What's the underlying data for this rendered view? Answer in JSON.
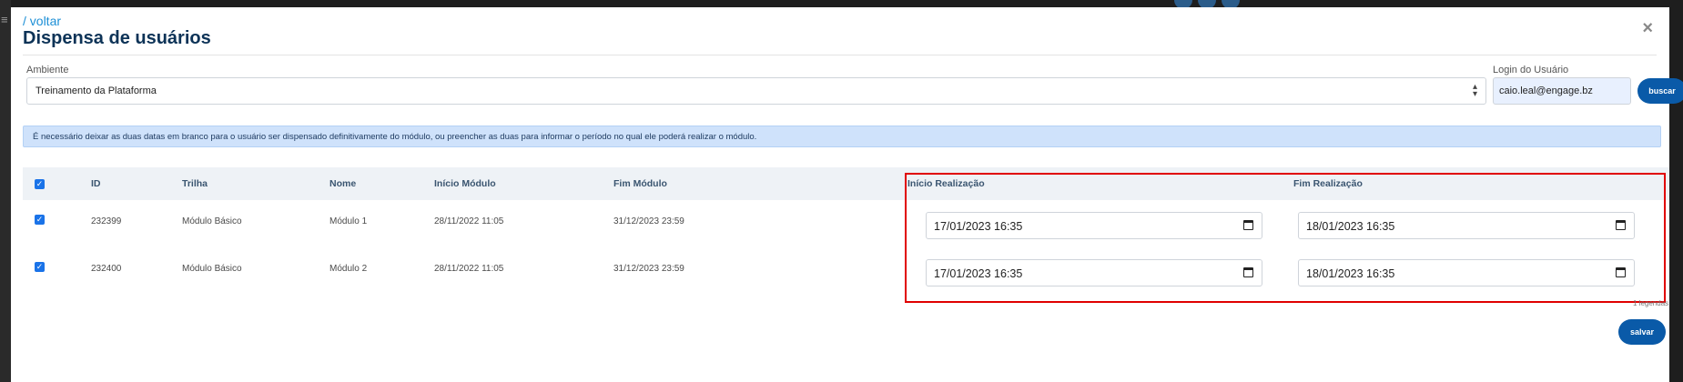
{
  "header": {
    "back_label": "/ voltar",
    "title": "Dispensa de usuários",
    "close_icon": "×"
  },
  "filters": {
    "ambiente_label": "Ambiente",
    "ambiente_value": "Treinamento da Plataforma",
    "login_label": "Login do Usuário",
    "login_value": "caio.leal@engage.bz",
    "buscar_label": "buscar"
  },
  "alert": {
    "text": "É necessário deixar as duas datas em branco para o usuário ser dispensado definitivamente do módulo, ou preencher as duas para informar o período no qual ele poderá realizar o módulo."
  },
  "table": {
    "columns": [
      "ID",
      "Trilha",
      "Nome",
      "Início Módulo",
      "Fim Módulo",
      "Início Realização",
      "Fim Realização"
    ],
    "rows": [
      {
        "checked": true,
        "id": "232399",
        "trilha": "Módulo Básico",
        "nome": "Módulo 1",
        "inicio_modulo": "28/11/2022 11:05",
        "fim_modulo": "31/12/2023 23:59",
        "inicio_realizacao": "17/01/2023 16:35",
        "fim_realizacao": "18/01/2023 16:35"
      },
      {
        "checked": true,
        "id": "232400",
        "trilha": "Módulo Básico",
        "nome": "Módulo 2",
        "inicio_modulo": "28/11/2022 11:05",
        "fim_modulo": "31/12/2023 23:59",
        "inicio_realizacao": "17/01/2023 16:35",
        "fim_realizacao": "18/01/2023 16:35"
      }
    ]
  },
  "footer": {
    "legend_text": "1 legendas",
    "save_label": "salvar"
  },
  "colors": {
    "accent": "#0a5aa8",
    "highlight": "#e00000",
    "alert_bg": "#cfe2fb",
    "title": "#0d3357"
  },
  "icons": [
    "close-icon",
    "select-arrow-icon",
    "calendar-icon",
    "checkbox-icon"
  ]
}
